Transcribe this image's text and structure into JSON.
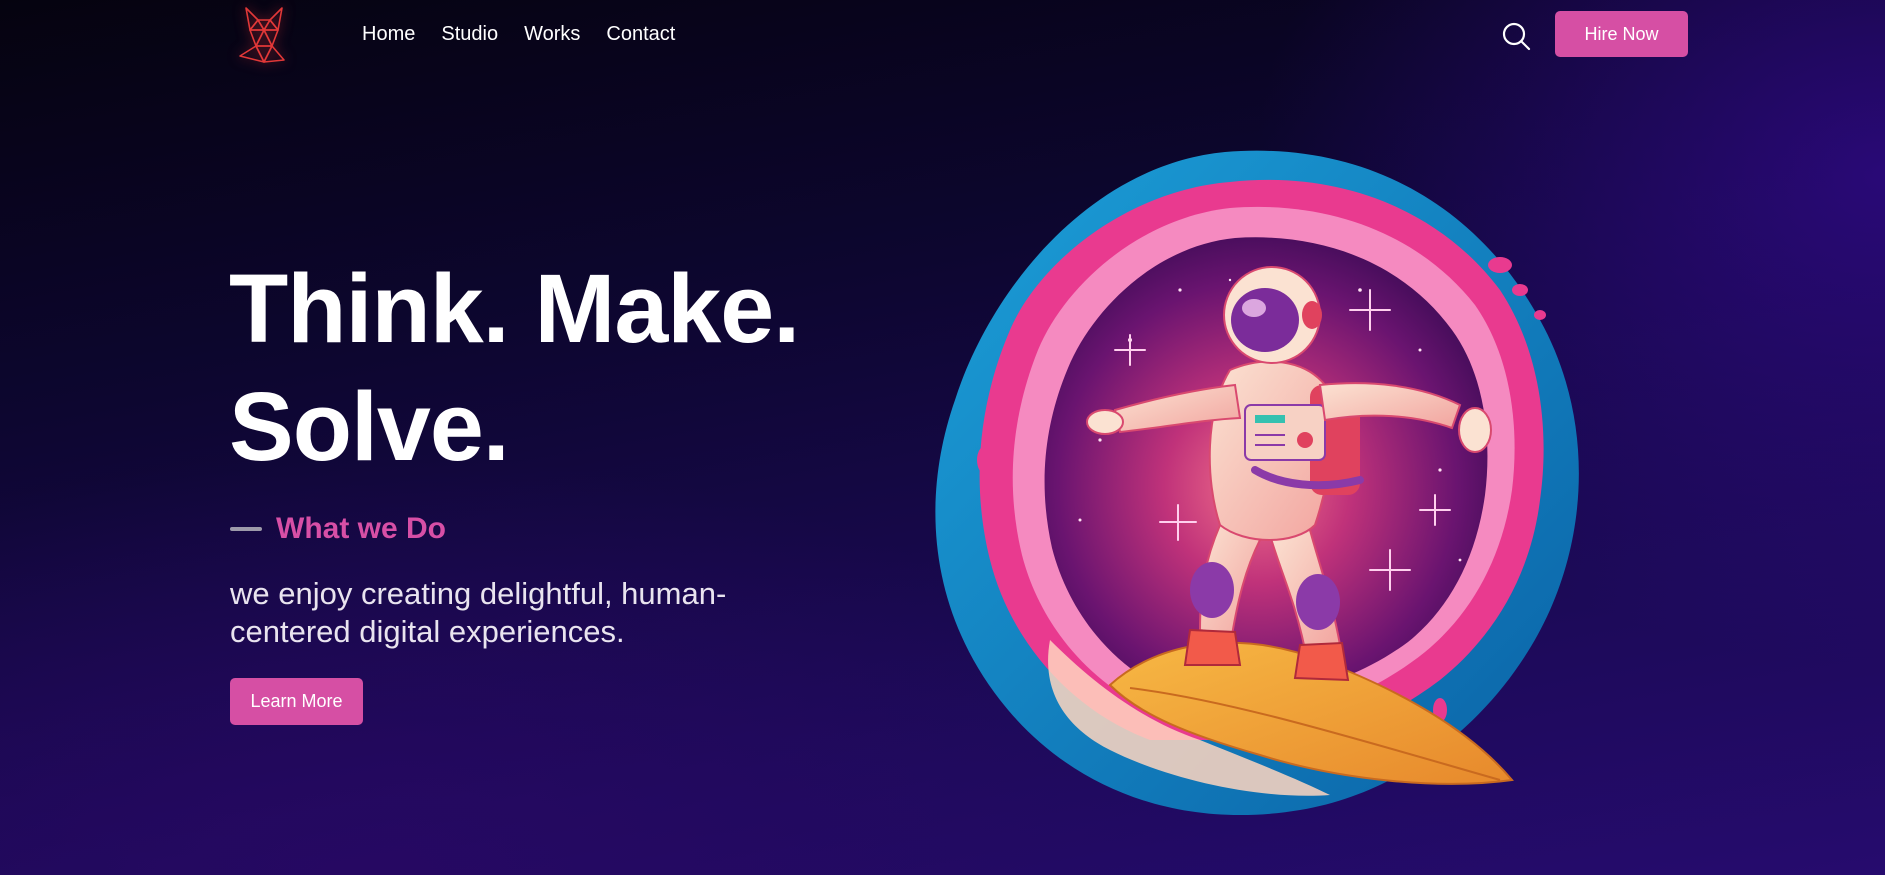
{
  "nav": {
    "logo_icon": "geometric-fox-logo",
    "links": [
      "Home",
      "Studio",
      "Works",
      "Contact"
    ],
    "search_icon": "search-icon",
    "hire_label": "Hire Now"
  },
  "hero": {
    "title_line1": "Think. Make.",
    "title_line2": "Solve.",
    "section_label": "What we Do",
    "description": "we enjoy creating delightful, human-centered digital experiences.",
    "cta_label": "Learn More",
    "illustration": "astronaut-surfing-space-wave-illustration"
  },
  "colors": {
    "accent": "#d64fa4",
    "background_top": "#05030f",
    "background_bottom": "#260b6e",
    "text": "#ffffff"
  }
}
